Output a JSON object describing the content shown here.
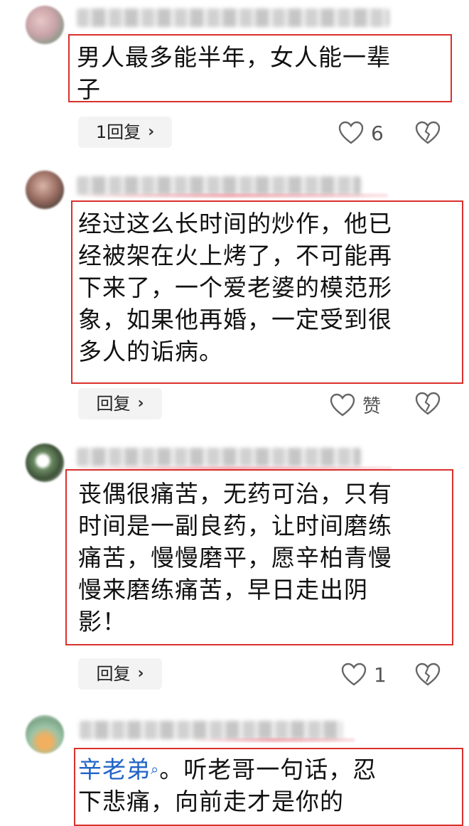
{
  "comments": [
    {
      "text": "男人最多能半年，女人能一辈\n子",
      "reply_label": "1回复",
      "like_count": "6"
    },
    {
      "text": "经过这么长时间的炒作，他已\n经被架在火上烤了，不可能再\n下来了，一个爱老婆的模范形\n象，如果他再婚，一定受到很\n多人的诟病。",
      "reply_label": "回复",
      "like_count": "赞"
    },
    {
      "text": "丧偶很痛苦，无药可治，只有\n时间是一副良药，让时间磨练\n痛苦，慢慢磨平，愿辛柏青慢\n慢来磨练痛苦，早日走出阴\n影！",
      "reply_label": "回复",
      "like_count": "1"
    },
    {
      "mention": "辛老弟",
      "text": "。听老哥一句话，忍\n下悲痛，向前走才是你的"
    }
  ],
  "icons": {
    "like": "heart-outline-icon",
    "dislike": "broken-heart-icon",
    "reply_arrow": "chevron-right-icon",
    "mention_search": "search-icon"
  },
  "colors": {
    "highlight_border": "#d9302c",
    "mention": "#2164c7"
  }
}
